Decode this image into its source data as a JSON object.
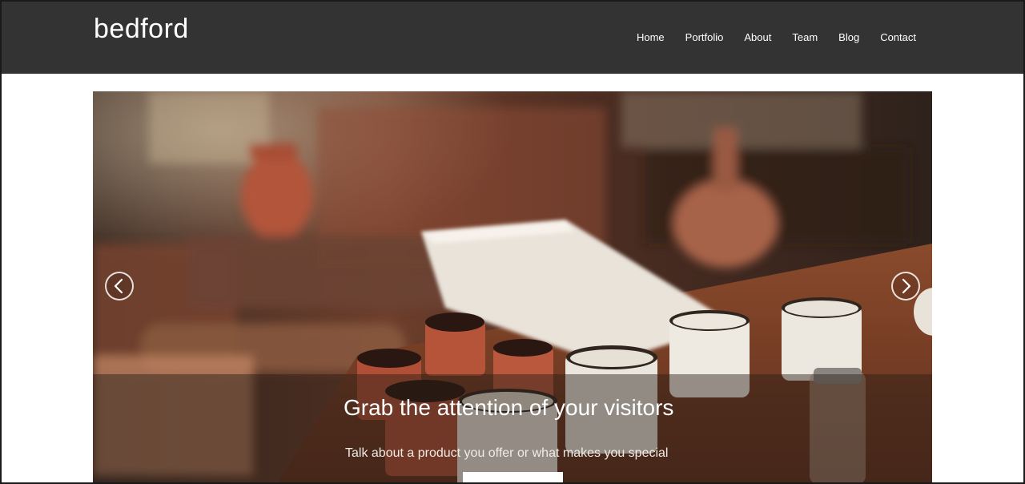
{
  "site": {
    "logo": "bedford"
  },
  "nav": {
    "items": [
      {
        "label": "Home"
      },
      {
        "label": "Portfolio"
      },
      {
        "label": "About"
      },
      {
        "label": "Team"
      },
      {
        "label": "Blog"
      },
      {
        "label": "Contact"
      }
    ]
  },
  "hero": {
    "title": "Grab the attention of your visitors",
    "subtitle": "Talk about a product you offer or what makes you special",
    "prev_icon": "chevron-left-icon",
    "next_icon": "chevron-right-icon"
  },
  "colors": {
    "header_bg": "#333333",
    "page_bg": "#ffffff",
    "text_light": "#ffffff"
  }
}
